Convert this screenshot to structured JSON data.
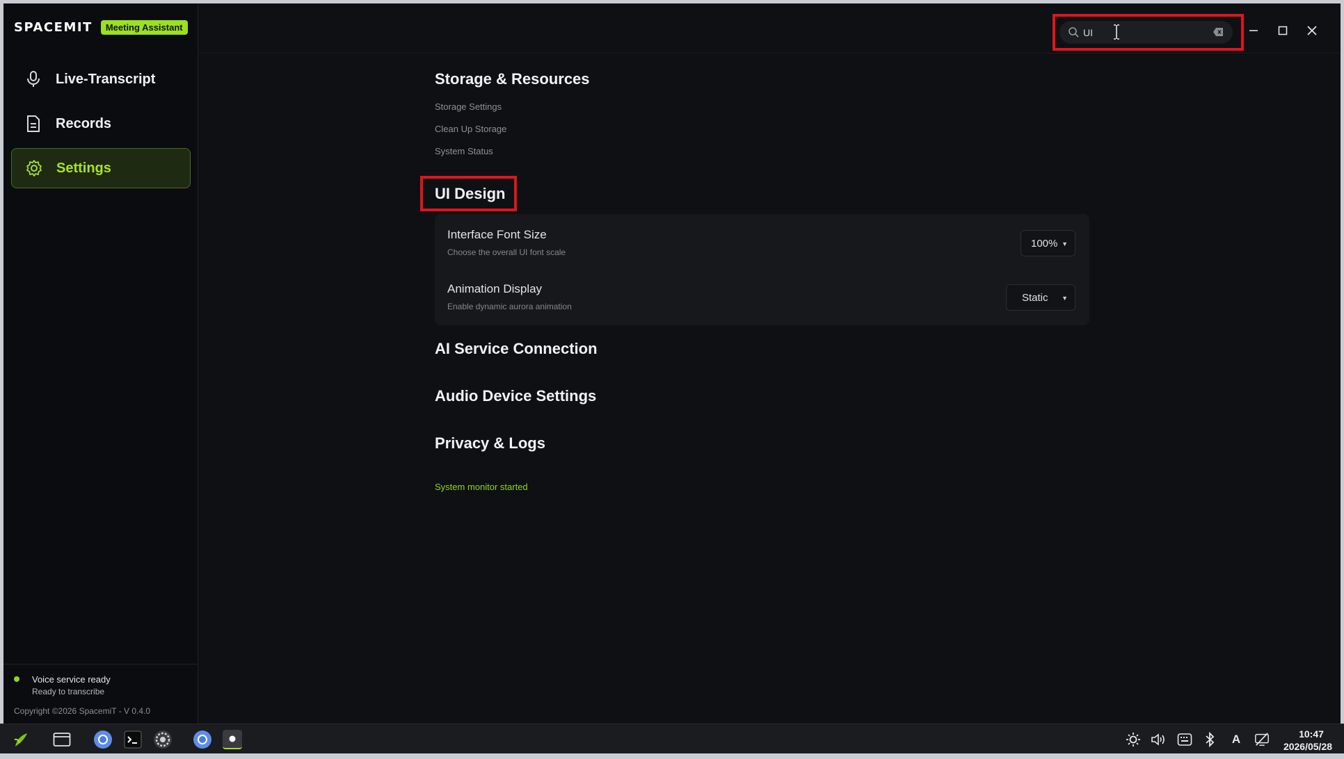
{
  "app": {
    "brand": "SPACEMIT",
    "badge": "Meeting Assistant"
  },
  "sidebar": {
    "items": [
      {
        "label": "Live-Transcript",
        "icon": "microphone-icon",
        "active": false
      },
      {
        "label": "Records",
        "icon": "document-icon",
        "active": false
      },
      {
        "label": "Settings",
        "icon": "gear-icon",
        "active": true
      }
    ],
    "status_title": "Voice service ready",
    "status_sub": "Ready to transcribe",
    "copyright": "Copyright ©2026 SpacemiT - V 0.4.0"
  },
  "search": {
    "value": "UI",
    "placeholder": ""
  },
  "sections": {
    "storage": {
      "title": "Storage & Resources",
      "links": [
        "Storage Settings",
        "Clean Up Storage",
        "System Status"
      ]
    },
    "ui_design": {
      "title": "UI Design",
      "font_size_title": "Interface Font Size",
      "font_size_desc": "Choose the overall UI font scale",
      "font_size_value": "100%",
      "animation_title": "Animation Display",
      "animation_desc": "Enable dynamic aurora animation",
      "animation_value": "Static"
    },
    "ai": {
      "title": "AI Service Connection"
    },
    "audio": {
      "title": "Audio Device Settings"
    },
    "privacy": {
      "title": "Privacy & Logs"
    }
  },
  "status_message": "System monitor started",
  "taskbar": {
    "time": "10:47",
    "date": "2026/05/28"
  },
  "colors": {
    "accent": "#9be023",
    "highlight": "#e0141e",
    "background": "#0f1013"
  }
}
